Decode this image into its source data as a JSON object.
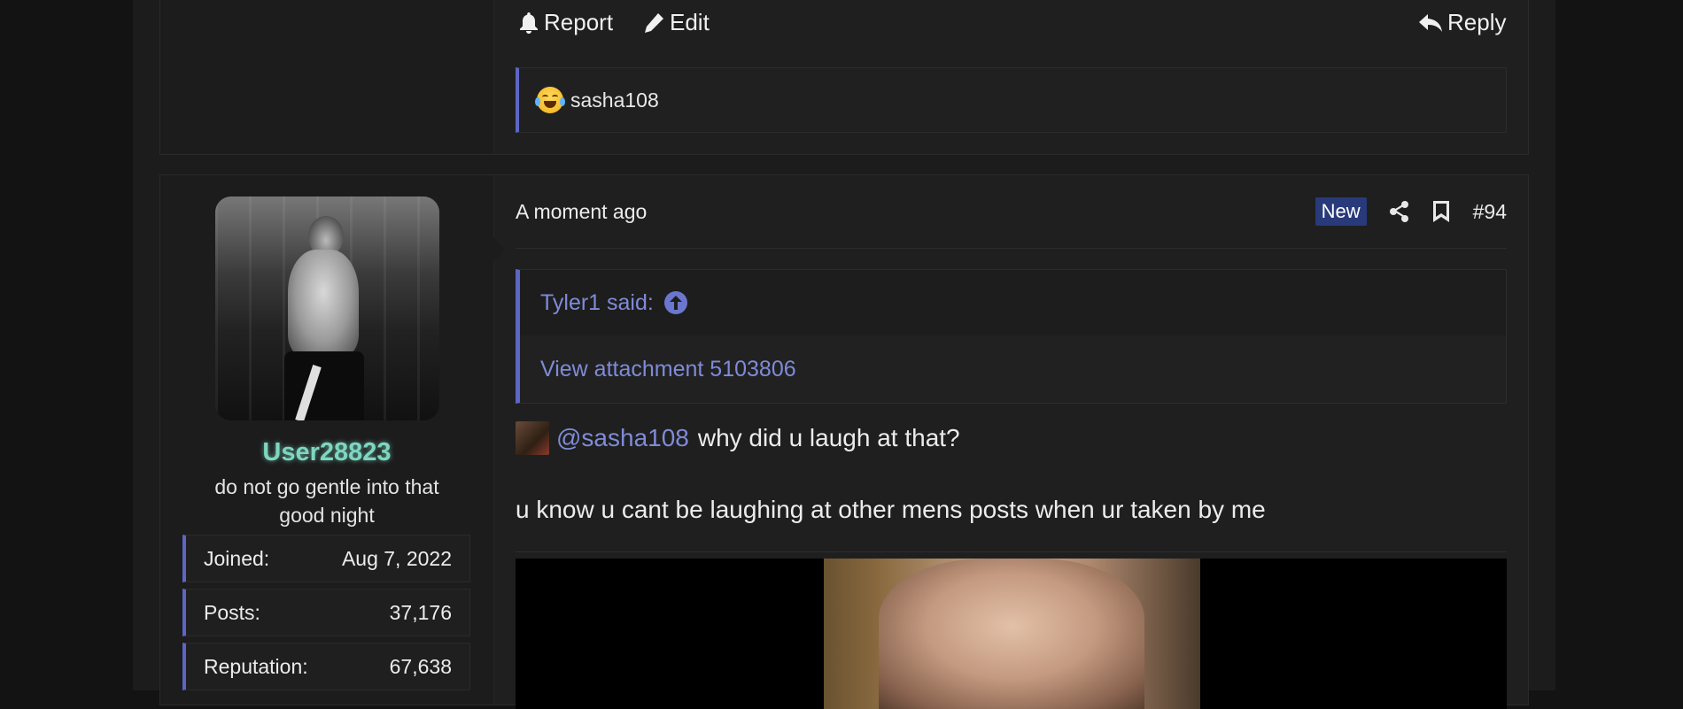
{
  "prev_post": {
    "actions": {
      "report": "Report",
      "edit": "Edit",
      "reply": "Reply"
    },
    "reaction_user": "sasha108",
    "reaction_icon": "laughing-tears-emoji"
  },
  "post": {
    "author": {
      "username": "User28823",
      "title": "do not go gentle into that good night",
      "stats": [
        {
          "label": "Joined:",
          "value": "Aug 7, 2022"
        },
        {
          "label": "Posts:",
          "value": "37,176"
        },
        {
          "label": "Reputation:",
          "value": "67,638"
        }
      ]
    },
    "time": "A moment ago",
    "badge": "New",
    "number": "#94",
    "quote": {
      "author_said": "Tyler1 said:",
      "attachment": "View attachment 5103806"
    },
    "mention": "@sasha108",
    "mention_rest": "why did u laugh at that?",
    "body": "u know u cant be laughing at other mens posts when ur taken by me"
  },
  "colors": {
    "accent": "#5c66c4",
    "link": "#7f8bd8",
    "username": "#7ed6c0",
    "badge_bg": "#283a7a",
    "background": "#1f1f1f"
  }
}
